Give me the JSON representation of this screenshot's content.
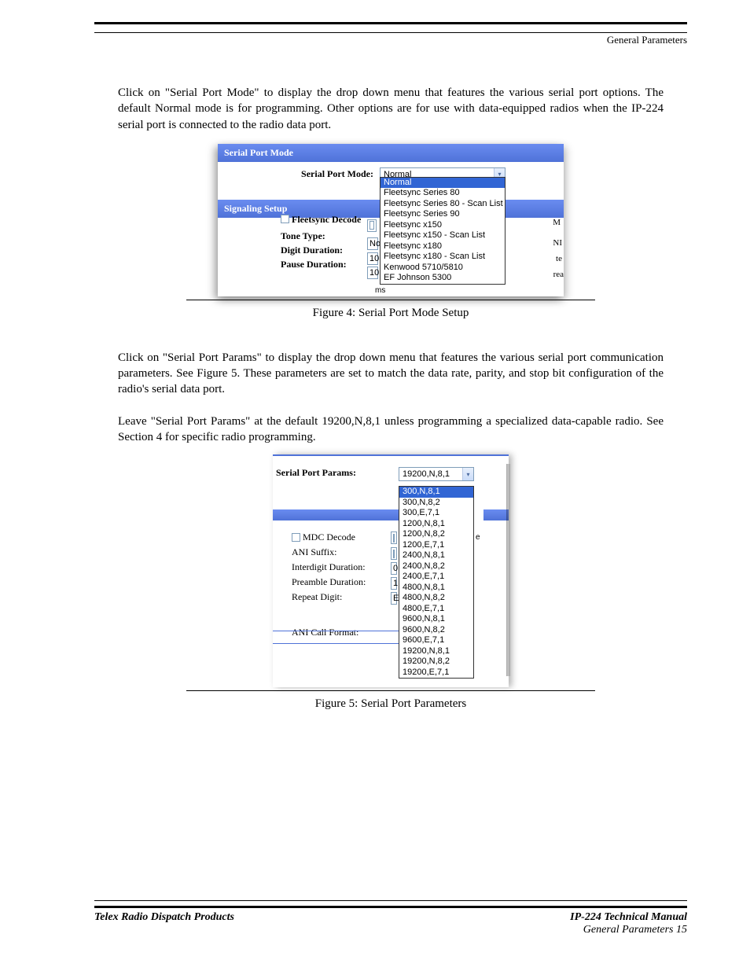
{
  "header": {
    "topic": "General Parameters"
  },
  "para1": "Click on \"Serial Port Mode\" to display the drop down menu that features the various serial port options. The default Normal mode is for programming. Other options are for use with data-equipped radios when the IP-224 serial port is connected to the radio data port.",
  "fig1": {
    "panels": {
      "serialPortMode_hdr": "Serial Port Mode",
      "signalingSetup_hdr": "Signaling Setup"
    },
    "labels": {
      "serialPortMode": "Serial Port Mode:",
      "fleetsyncDecode": "Fleetsync Decode",
      "toneType": "Tone Type:",
      "digitDuration": "Digit Duration:",
      "pauseDuration": "Pause Duration:"
    },
    "combo_value": "Normal",
    "sideChars": {
      "m": "M",
      "ni": "NI",
      "te": "te",
      "rea": "rea"
    },
    "miniVals": {
      "tone": "No",
      "digit": "10",
      "pause": "10"
    },
    "dropdown": [
      "Normal",
      "Fleetsync Series 80",
      "Fleetsync Series 80 - Scan List",
      "Fleetsync Series 90",
      "Fleetsync x150",
      "Fleetsync x150 - Scan List",
      "Fleetsync x180",
      "Fleetsync x180 - Scan List",
      "Kenwood 5710/5810",
      "EF Johnson 5300"
    ],
    "caption": "Figure 4:  Serial Port Mode Setup"
  },
  "para2a": "Click on \"Serial Port Params\" to display the drop down menu that features the various serial port communication parameters. See Figure 5. These parameters are set to match the data rate, parity, and stop bit configuration of the radio's serial data port.",
  "para2b": "Leave \"Serial Port Params\" at the default 19200,N,8,1 unless programming a specialized data-capable radio. See Section 4 for specific radio programming.",
  "fig2": {
    "leftLabel": "Serial Port Params:",
    "combo_value": "19200,N,8,1",
    "leftRows": {
      "mdc": "MDC Decode",
      "aniSuffix": "ANI Suffix:",
      "interdigit": "Interdigit Duration:",
      "preamble": "Preamble Duration:",
      "repeat": "Repeat Digit:",
      "aniCall": "ANI Call Format:"
    },
    "miniVals": {
      "interdigit": "0",
      "preamble": "1",
      "repeat": "E",
      "e": "e"
    },
    "dropdown": [
      "300,N,8,1",
      "300,N,8,2",
      "300,E,7,1",
      "1200,N,8,1",
      "1200,N,8,2",
      "1200,E,7,1",
      "2400,N,8,1",
      "2400,N,8,2",
      "2400,E,7,1",
      "4800,N,8,1",
      "4800,N,8,2",
      "4800,E,7,1",
      "9600,N,8,1",
      "9600,N,8,2",
      "9600,E,7,1",
      "19200,N,8,1",
      "19200,N,8,2",
      "19200,E,7,1"
    ],
    "caption": "Figure 5:  Serial Port Parameters"
  },
  "footer": {
    "left": "Telex Radio Dispatch Products",
    "rightTitle": "IP-224 Technical Manual",
    "rightPage": "General Parameters  15"
  }
}
